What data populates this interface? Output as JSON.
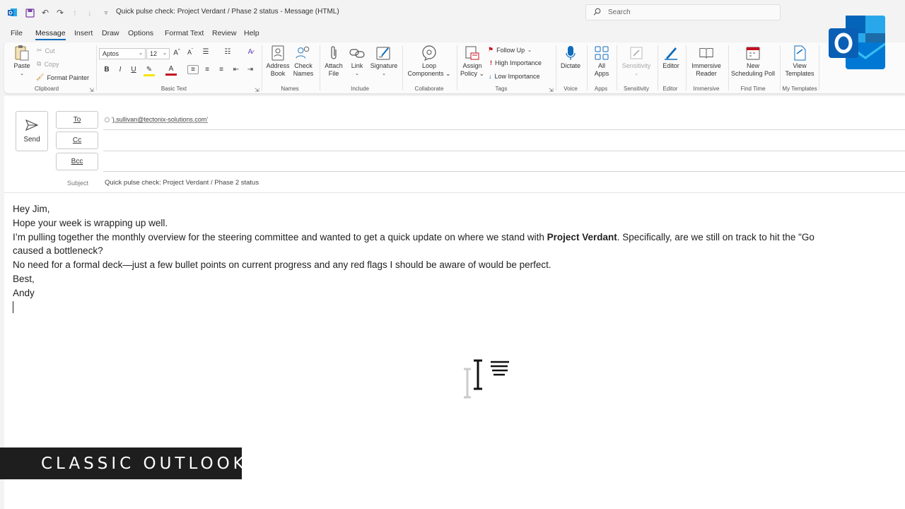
{
  "window": {
    "title": "Quick pulse check: Project Verdant / Phase 2 status  -  Message (HTML)",
    "search_placeholder": "Search"
  },
  "menu": {
    "tabs": [
      "File",
      "Message",
      "Insert",
      "Draw",
      "Options",
      "Format Text",
      "Review",
      "Help"
    ],
    "active": "Message"
  },
  "ribbon": {
    "clipboard": {
      "paste": "Paste",
      "cut": "Cut",
      "copy": "Copy",
      "format_painter": "Format Painter",
      "label": "Clipboard"
    },
    "basic_text": {
      "font": "Aptos",
      "size": "12",
      "bold": "B",
      "italic": "I",
      "underline": "U",
      "font_color": "A",
      "label": "Basic Text"
    },
    "names": {
      "address_book": [
        "Address",
        "Book"
      ],
      "check_names": [
        "Check",
        "Names"
      ],
      "label": "Names"
    },
    "include": {
      "attach_file": [
        "Attach",
        "File"
      ],
      "link": "Link",
      "signature": "Signature",
      "label": "Include"
    },
    "collaborate": {
      "loop": [
        "Loop",
        "Components"
      ],
      "label": "Collaborate"
    },
    "tags": {
      "assign_policy": [
        "Assign",
        "Policy"
      ],
      "follow_up": "Follow Up",
      "high_importance": "High Importance",
      "low_importance": "Low Importance",
      "label": "Tags"
    },
    "voice": {
      "dictate": "Dictate",
      "label": "Voice"
    },
    "apps": {
      "all_apps": [
        "All",
        "Apps"
      ],
      "label": "Apps"
    },
    "sensitivity": {
      "button": "Sensitivity",
      "label": "Sensitivity"
    },
    "editor": {
      "button": "Editor",
      "label": "Editor"
    },
    "immersive": {
      "button": [
        "Immersive",
        "Reader"
      ],
      "label": "Immersive"
    },
    "find_time": {
      "button": [
        "New",
        "Scheduling Poll"
      ],
      "label": "Find Time"
    },
    "templates": {
      "button": [
        "View",
        "Templates"
      ],
      "label": "My Templates"
    }
  },
  "compose": {
    "send": "Send",
    "to_label": "To",
    "cc_label": "Cc",
    "bcc_label": "Bcc",
    "to_value": "'j.sullivan@tectonix-solutions.com'",
    "subject_label": "Subject",
    "subject": "Quick pulse check: Project Verdant / Phase 2 status",
    "body": {
      "greeting": "Hey Jim,",
      "line1": "Hope your week is wrapping up well.",
      "line2_pre": "I’m pulling together the monthly overview for the steering committee and wanted to get a quick update on where we stand with ",
      "line2_bold": "Project Verdant",
      "line2_post": ". Specifically, are we still on track to hit the \"Go",
      "line3": "caused a bottleneck?",
      "line4": "No need for a formal deck—just a few bullet points on current progress and any red flags I should be aware of would be perfect.",
      "closing": "Best,",
      "signature": "Andy"
    }
  },
  "banner": {
    "text": "CLASSIC OUTLOOK"
  },
  "colors": {
    "accent": "#0f6cbd",
    "outlook_blue": "#0a5fb4",
    "flag_red": "#c50f1f",
    "save_purple": "#7b3fa8"
  }
}
